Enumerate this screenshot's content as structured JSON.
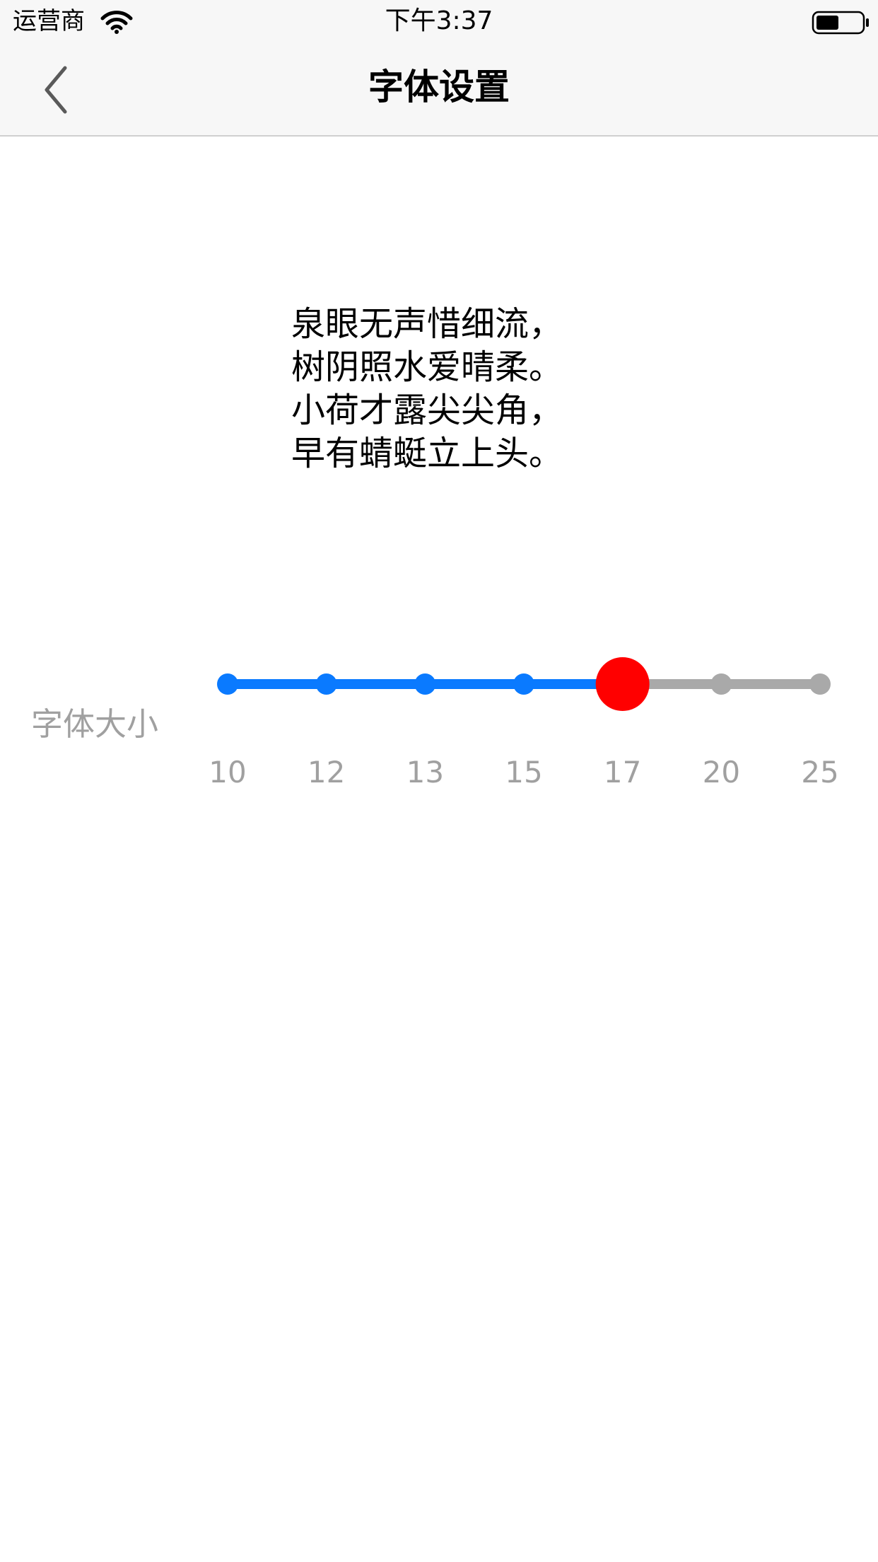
{
  "status_bar": {
    "carrier": "运营商",
    "time": "下午3:37",
    "battery_level": 0.5
  },
  "nav": {
    "title": "字体设置"
  },
  "preview": {
    "lines": [
      "泉眼无声惜细流，",
      "树阴照水爱晴柔。",
      "小荷才露尖尖角，",
      "早有蜻蜓立上头。"
    ]
  },
  "font_size": {
    "label": "字体大小",
    "options": [
      "10",
      "12",
      "13",
      "15",
      "17",
      "20",
      "25"
    ],
    "selected": "17",
    "colors": {
      "active": "#0a7aff",
      "inactive": "#a9a9a9",
      "thumb": "#ff0000"
    }
  }
}
